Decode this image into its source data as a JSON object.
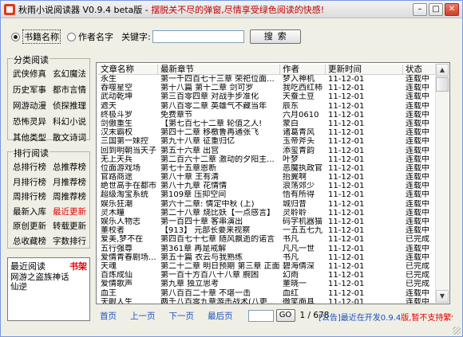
{
  "window": {
    "title": "秋雨小说阅读器 V0.9.4 beta版 - ",
    "slogan": "摆脱关不尽的弹窗,尽情享受绿色阅读的快感!",
    "minimize_glyph": "–",
    "maximize_glyph": "□",
    "close_glyph": "✕"
  },
  "search": {
    "radio_name": "书籍名称",
    "radio_author": "作者名字",
    "keyword_label": "关键字:",
    "keyword_value": "",
    "button": "搜索"
  },
  "categories": {
    "title": "分类阅读",
    "items": [
      "武侠修真",
      "玄幻魔法",
      "历史军事",
      "都市言情",
      "网游动漫",
      "侦探推理",
      "恐怖灵异",
      "科幻小说",
      "其他类型",
      "散文诗词"
    ]
  },
  "rankings": {
    "title": "排行阅读",
    "items": [
      "总排行榜",
      "总推荐榜",
      "月排行榜",
      "月推荐榜",
      "周排行榜",
      "周推荐榜",
      "最新入库",
      "最近更新",
      "原创更新",
      "转载更新",
      "总收藏榜",
      "字数排行"
    ]
  },
  "recent": {
    "title": "最近阅读",
    "bookshelf": "书架",
    "items": [
      "网游之盗族神话",
      "仙逆"
    ]
  },
  "table": {
    "headers": [
      "文章名称",
      "最新章节",
      "作者",
      "更新时间",
      "状态"
    ],
    "rows": [
      [
        "永生",
        "第一千四百七十三章 荣祀位面...",
        "梦入神机",
        "11-12-01",
        "连载中"
      ],
      [
        "吞噬星空",
        "第十八篇 第十二章 剑可罗",
        "我吃西红柿",
        "11-12-01",
        "连载中"
      ],
      [
        "武动乾坤",
        "第三百零四章 对战手步准化",
        "天蚕土豆",
        "11-12-01",
        "连载中"
      ],
      [
        "遮天",
        "第八百零二章 英雄气不藏当年",
        "辰东",
        "11-12-01",
        "连载中"
      ],
      [
        "终极斗罗",
        "免费章节",
        "六月0610",
        "11-12-01",
        "连载中"
      ],
      [
        "剑傲重生",
        "【第七百七十二章 轮值之人!",
        "蒙白",
        "11-12-01",
        "连载中"
      ],
      [
        "汉末霸权",
        "第四十二章 移檄鲁再通张飞",
        "诸葛青风",
        "11-12-01",
        "连载中"
      ],
      [
        "三国第一妹控",
        "第九十八章 征重归亿",
        "玉帝斧头",
        "11-12-01",
        "连载中"
      ],
      [
        "回到明朝当天子",
        "第五十六章 出宫",
        "添玺青韵",
        "11-12-01",
        "连载中"
      ],
      [
        "无上天兵",
        "第二百六十二章 激动的夕阳主...",
        "叶梦",
        "11-12-01",
        "连载中"
      ],
      [
        "位面游戏场",
        "第七十五章恩断",
        "恶魔执政官",
        "11-12-01",
        "连载中"
      ],
      [
        "官路商途",
        "第八十章 王有清",
        "抬翼啊",
        "11-12-01",
        "连载中"
      ],
      [
        "绝世高手在都市",
        "第八十九章 花情情",
        "浪荡郊少",
        "11-12-01",
        "连载中"
      ],
      [
        "超级淘宝系统",
        "第109章 压抑空间",
        "悟有所得",
        "11-12-01",
        "连载中"
      ],
      [
        "娱乐狂潮",
        "第六十二章: 情定中秋 (上)",
        "城归昔",
        "11-12-01",
        "连载中"
      ],
      [
        "灵木瞳",
        "第二十八章 烧比妖【一点感言】",
        "灵聆聆",
        "11-12-01",
        "连载中"
      ],
      [
        "娱乐人物志",
        "第一百四十章 客串演出",
        "码字机器猫",
        "11-12-01",
        "连载中"
      ],
      [
        "董校者",
        "【913】 元部长要来视察",
        "一五五七九",
        "11-12-01",
        "连载中"
      ],
      [
        "爱美,梦不在",
        "第四百七十七章 随风飘逝的诺言",
        "书凡",
        "11-12-01",
        "已完成"
      ],
      [
        "五行强尊",
        "第361章 再是戒解",
        "凡凡一世",
        "11-12-01",
        "连载中"
      ],
      [
        "爱情青春剧场...",
        "第五十篇 衣云与我熟练",
        "书凡",
        "11-12-01",
        "连载中"
      ],
      [
        "天魂",
        "第二十二章 明日预期 第三章 正面",
        "碧海倩深",
        "11-12-01",
        "已完成"
      ],
      [
        "百炼成仙",
        "第一百十方百八十八章 腕困",
        "幻雨",
        "11-12-01",
        "已完成"
      ],
      [
        "爱情歌声",
        "第九章 独立思考",
        "董晓一",
        "11-12-01",
        "已完成"
      ],
      [
        "血王",
        "第八百百二十章 不堪一击",
        "血红",
        "11-12-01",
        "连载中"
      ],
      [
        "天眼人生",
        "两千八百零九章游击战术(八更...",
        "微笑面具",
        "11-12-01",
        "连载中"
      ],
      [
        "穿越之我是潘...",
        "第十七章 移入意门(求收藏推...",
        "风月西门庄",
        "11-12-01",
        "连载中"
      ],
      [
        "衰天记",
        "第七十七章 五彩极丹",
        "风凌天下",
        "11-12-01",
        "连载中"
      ],
      [
        "核能神通",
        "第一百五十三章: 地球入侵之后...",
        "帝皇龙威",
        "11-12-01",
        "连载中"
      ],
      [
        "网游之盗族神话",
        "第五十二章 空亡岛空转",
        "独家羽",
        "11-12-01",
        "连载中"
      ]
    ]
  },
  "pager": {
    "first": "首页",
    "prev": "上一页",
    "next": "下一页",
    "last": "最后页",
    "page_value": "",
    "go": "GO",
    "count": "1 / 678"
  },
  "notice": {
    "prefix": "[公告]最近在开发0.9.4",
    "accent": "版,暂不支持繁体",
    "suffix": "阅读"
  }
}
